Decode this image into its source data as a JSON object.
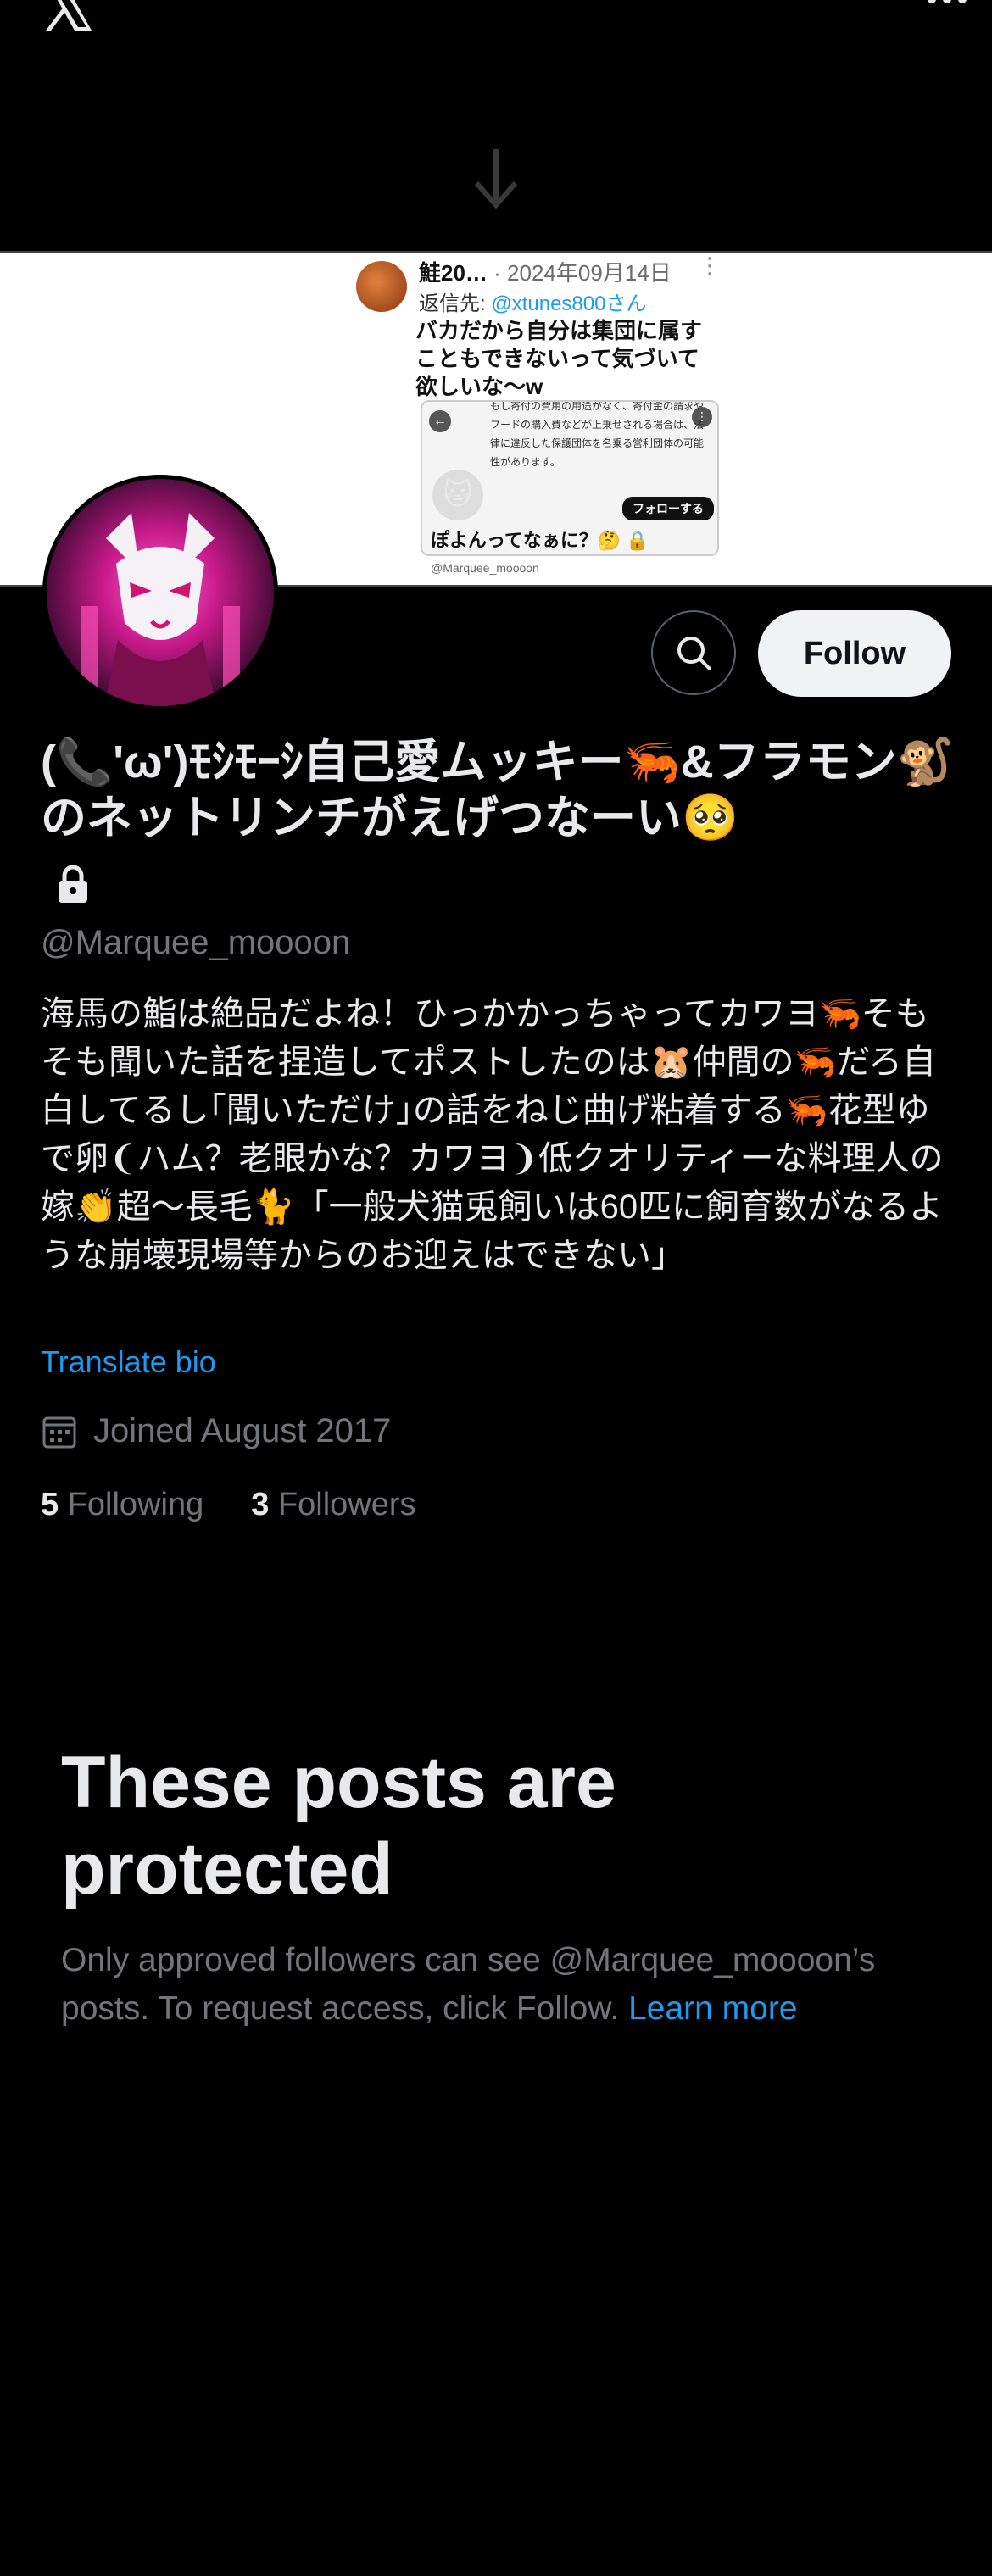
{
  "topbar": {
    "logo_icon": "x-logo-icon",
    "more_icon": "more-dots-icon"
  },
  "banner": {
    "tweet_name": "鮭20…",
    "tweet_date": "· 2024年09月14日",
    "reply_prefix": "返信先:",
    "reply_handle": "@xtunes800さん",
    "tweet_text": "バカだから自分は集団に属すこともできないって気づいて欲しいな〜w",
    "quote_text": "もし寄付の費用の用途がなく、寄付金の請求やフードの購入費などが上乗せされる場合は、法律に違反した保護団体を名乗る営利団体の可能性があります。",
    "quote_follow": "フォローする",
    "quote_question": "ぽよんってなぁに？🤔 🔒",
    "footer_handle": "@Marquee_moooon"
  },
  "profile": {
    "follow_label": "Follow",
    "display_name": "(📞'ω')ﾓｼﾓｰｼ自己愛ムッキー🦐&フラモン🐒のネットリンチがえげつなーい🥺",
    "handle": "@Marquee_moooon",
    "bio": "海馬の鮨は絶品だよね！ひっかかっちゃってカワヨ🦐そもそも聞いた話を捏造してポストしたのは🐹仲間の🦐だろ自白してるし｢聞いただけ｣の話をねじ曲げ粘着する🦐花型ゆで卵❨ハム？老眼かな？カワヨ❩低クオリティーな料理人の嫁👏超〜長毛🐈「一般犬猫兎飼いは60匹に飼育数がなるような崩壊現場等からのお迎えはできない｣",
    "translate_label": "Translate bio",
    "joined": "Joined August 2017",
    "following_count": "5",
    "following_label": "Following",
    "followers_count": "3",
    "followers_label": "Followers"
  },
  "protected": {
    "title": "These posts are protected",
    "description": "Only approved followers can see @Marquee_moooon’s posts. To request access, click Follow. ",
    "learn_more": "Learn more"
  },
  "colors": {
    "background": "#000000",
    "link": "#1d9bf0",
    "muted": "#71767b",
    "text": "#e7e9ea"
  }
}
